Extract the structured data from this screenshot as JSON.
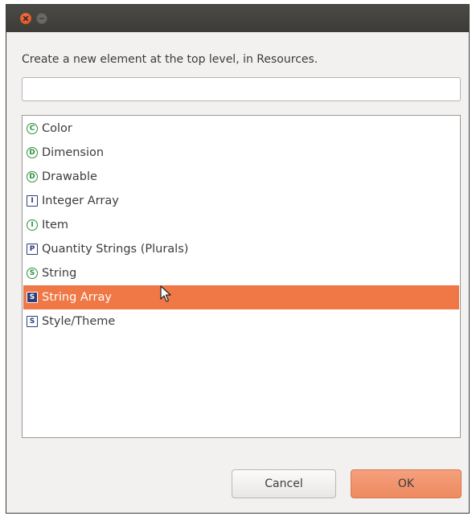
{
  "dialog": {
    "prompt": "Create a new element at the top level, in Resources.",
    "filter": {
      "value": "",
      "placeholder": ""
    }
  },
  "list": {
    "items": [
      {
        "label": "Color",
        "icon": "C",
        "icon_shape": "circle"
      },
      {
        "label": "Dimension",
        "icon": "D",
        "icon_shape": "circle"
      },
      {
        "label": "Drawable",
        "icon": "D",
        "icon_shape": "circle"
      },
      {
        "label": "Integer Array",
        "icon": "I",
        "icon_shape": "square"
      },
      {
        "label": "Item",
        "icon": "I",
        "icon_shape": "circle"
      },
      {
        "label": "Quantity Strings (Plurals)",
        "icon": "P",
        "icon_shape": "square"
      },
      {
        "label": "String",
        "icon": "S",
        "icon_shape": "circle"
      },
      {
        "label": "String Array",
        "icon": "S",
        "icon_shape": "square",
        "selected": true
      },
      {
        "label": "Style/Theme",
        "icon": "S",
        "icon_shape": "square"
      }
    ]
  },
  "buttons": {
    "cancel": "Cancel",
    "ok": "OK"
  },
  "colors": {
    "selection": "#f07746",
    "ok_button": "#ee8a5f",
    "titlebar": "#3c3b37",
    "circle_icon": "#2f8f3a",
    "square_icon": "#2c3e7a"
  }
}
